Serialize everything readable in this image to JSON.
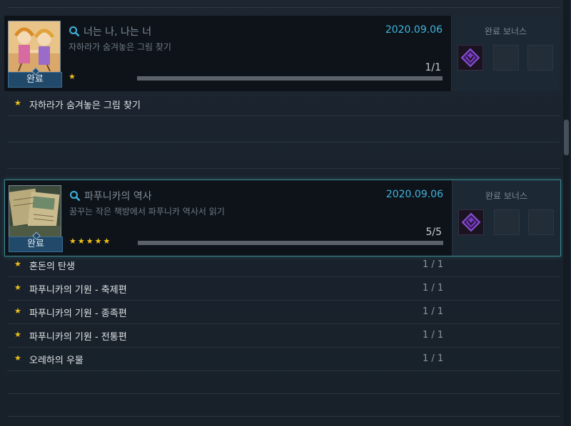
{
  "achievements": [
    {
      "title": "너는 나, 나는 너",
      "subtitle": "자하라가 숨겨놓은 그림 찾기",
      "date": "2020.09.06",
      "count": "1/1",
      "progress": 1.0,
      "stars": "★",
      "done_label": "완료",
      "bonus_title": "완료 보너스",
      "tasks": [
        {
          "label": "자하라가 숨겨놓은 그림 찾기",
          "progress": ""
        }
      ]
    },
    {
      "title": "파푸니카의 역사",
      "subtitle": "꿈꾸는 작은 책방에서 파푸니카 역사서 읽기",
      "date": "2020.09.06",
      "count": "5/5",
      "progress": 1.0,
      "stars": "★★★★★",
      "done_label": "완료",
      "bonus_title": "완료 보너스",
      "tasks": [
        {
          "label": "혼돈의 탄생",
          "progress": "1 / 1"
        },
        {
          "label": "파푸니카의 기원 - 축제편",
          "progress": "1 / 1"
        },
        {
          "label": "파푸니카의 기원 - 종족편",
          "progress": "1 / 1"
        },
        {
          "label": "파푸니카의 기원 - 전통편",
          "progress": "1 / 1"
        },
        {
          "label": "오레하의 우물",
          "progress": "1 / 1"
        }
      ]
    }
  ],
  "colors": {
    "accent": "#3fb5de",
    "star": "#f2c21a",
    "selected_border": "#3d8890",
    "reward_icon": "#7a3cc4"
  }
}
